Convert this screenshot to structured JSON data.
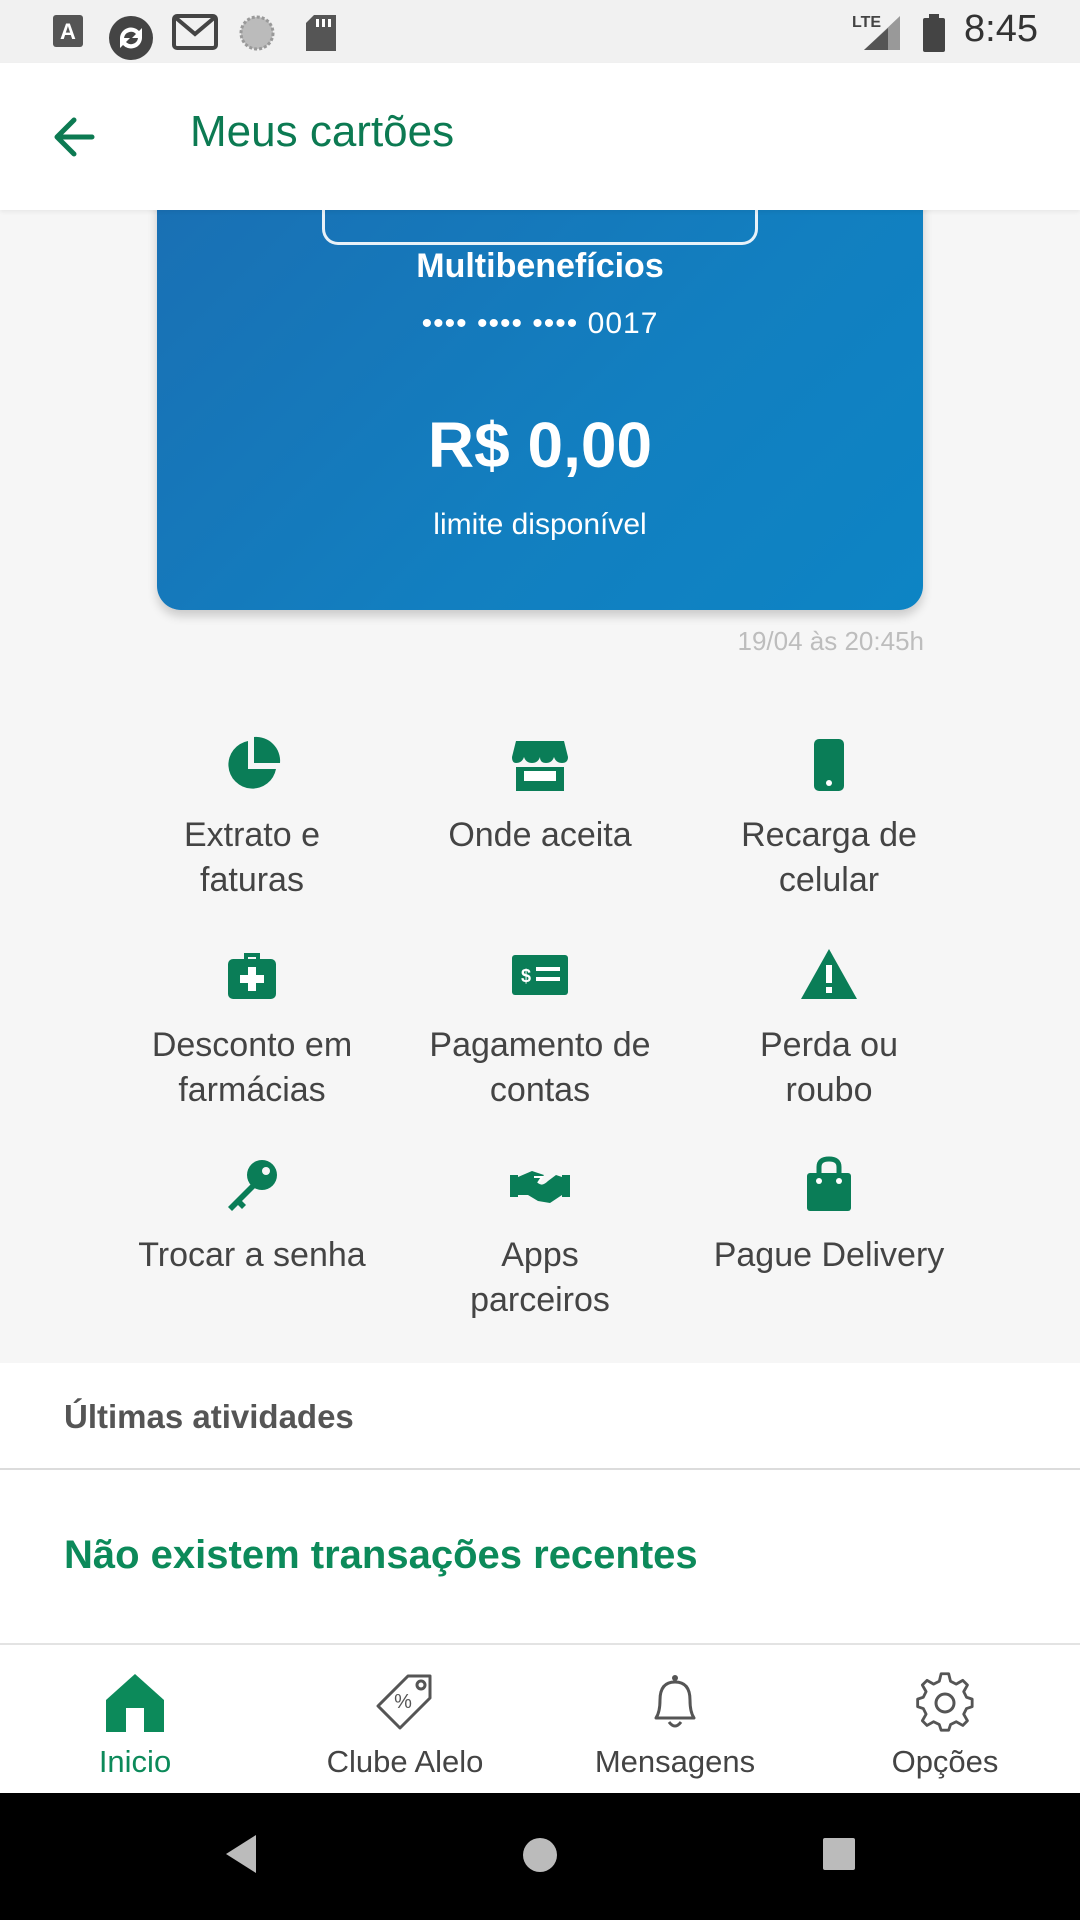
{
  "status_bar": {
    "time": "8:45",
    "network": "LTE",
    "icons": [
      "a-icon",
      "sync-icon",
      "gmail-icon",
      "circle-icon",
      "sd-card-icon",
      "signal-icon",
      "battery-icon"
    ]
  },
  "app_bar": {
    "title": "Meus cartões",
    "back_icon": "arrow-left-icon"
  },
  "card": {
    "label": "Multibenefícios",
    "number": "•••• •••• •••• 0017",
    "amount": "R$ 0,00",
    "limit_label": "limite disponível",
    "timestamp": "19/04 às 20:45h",
    "gradient_start": "#1a6fb3",
    "gradient_end": "#0d84c4"
  },
  "actions": [
    {
      "line1": "Extrato e",
      "line2": "faturas",
      "icon": "pie-chart-icon"
    },
    {
      "line1": "Onde aceita",
      "line2": "",
      "icon": "store-icon"
    },
    {
      "line1": "Recarga de",
      "line2": "celular",
      "icon": "phone-icon"
    },
    {
      "line1": "Desconto em",
      "line2": "farmácias",
      "icon": "medical-kit-icon"
    },
    {
      "line1": "Pagamento de",
      "line2": "contas",
      "icon": "bill-icon"
    },
    {
      "line1": "Perda ou",
      "line2": "roubo",
      "icon": "warning-icon"
    },
    {
      "line1": "Trocar a senha",
      "line2": "",
      "icon": "key-icon"
    },
    {
      "line1": "Apps",
      "line2": "parceiros",
      "icon": "handshake-icon"
    },
    {
      "line1": "Pague Delivery",
      "line2": "",
      "icon": "shopping-bag-icon"
    }
  ],
  "activities": {
    "title": "Últimas atividades",
    "empty_message": "Não existem transações recentes"
  },
  "bottom_nav": [
    {
      "label": "Inicio",
      "icon": "home-icon",
      "active": true
    },
    {
      "label": "Clube Alelo",
      "icon": "discount-tag-icon",
      "active": false
    },
    {
      "label": "Mensagens",
      "icon": "bell-icon",
      "active": false
    },
    {
      "label": "Opções",
      "icon": "gear-icon",
      "active": false
    }
  ],
  "colors": {
    "accent": "#0c7a52",
    "accent_light": "#0c8a5a",
    "icon_green": "#0a7d57"
  }
}
